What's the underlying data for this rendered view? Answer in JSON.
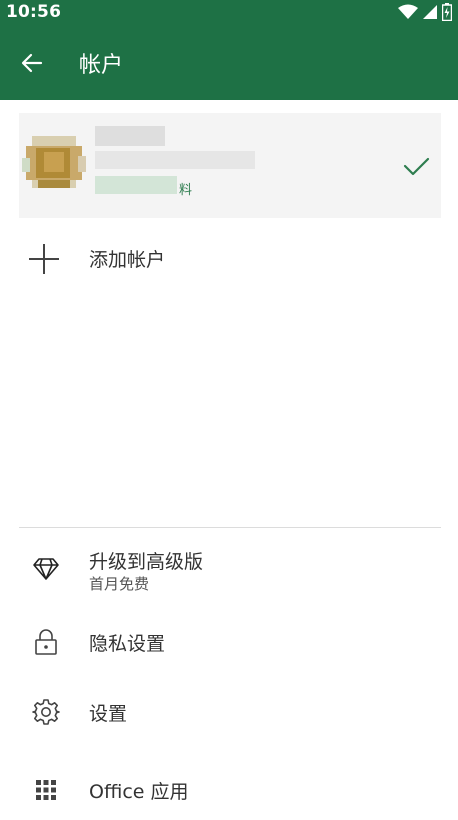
{
  "status_bar": {
    "time": "10:56"
  },
  "app_bar": {
    "title": "帐户"
  },
  "account": {
    "tag": "料"
  },
  "add_account": {
    "label": "添加帐户"
  },
  "menu": {
    "upgrade": {
      "label": "升级到高级版",
      "sub": "首月免费"
    },
    "privacy": {
      "label": "隐私设置"
    },
    "settings": {
      "label": "设置"
    },
    "office_apps": {
      "label": "Office 应用"
    }
  },
  "colors": {
    "brand": "#1e7145",
    "check": "#2e7d4f"
  }
}
